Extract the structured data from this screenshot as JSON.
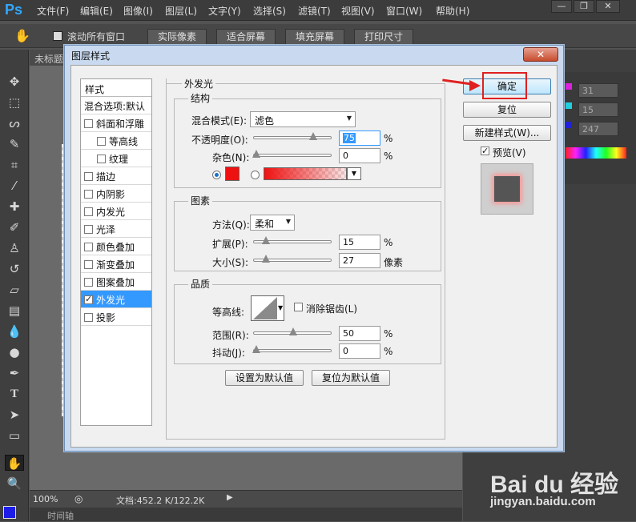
{
  "menubar": {
    "logo": "Ps",
    "items": [
      "文件(F)",
      "编辑(E)",
      "图像(I)",
      "图层(L)",
      "文字(Y)",
      "选择(S)",
      "滤镜(T)",
      "视图(V)",
      "窗口(W)",
      "帮助(H)"
    ],
    "win_buttons": [
      "—",
      "❐",
      "✕"
    ]
  },
  "options": {
    "scroll_all": "滚动所有窗口",
    "buttons": [
      "实际像素",
      "适合屏幕",
      "填充屏幕",
      "打印尺寸"
    ]
  },
  "document": {
    "tab": "未标题"
  },
  "right_panel": {
    "values": [
      "31",
      "15",
      "247"
    ]
  },
  "status": {
    "zoom": "100%",
    "doc": "文档:452.2 K/122.2K",
    "timeline": "时间轴"
  },
  "dialog": {
    "title": "图层样式",
    "styles_header": "样式",
    "blend_options": "混合选项:默认",
    "styles": [
      {
        "label": "斜面和浮雕",
        "checked": false,
        "indent": false
      },
      {
        "label": "等高线",
        "checked": false,
        "indent": true
      },
      {
        "label": "纹理",
        "checked": false,
        "indent": true
      },
      {
        "label": "描边",
        "checked": false,
        "indent": false
      },
      {
        "label": "内阴影",
        "checked": false,
        "indent": false
      },
      {
        "label": "内发光",
        "checked": false,
        "indent": false
      },
      {
        "label": "光泽",
        "checked": false,
        "indent": false
      },
      {
        "label": "颜色叠加",
        "checked": false,
        "indent": false
      },
      {
        "label": "渐变叠加",
        "checked": false,
        "indent": false
      },
      {
        "label": "图案叠加",
        "checked": false,
        "indent": false
      },
      {
        "label": "外发光",
        "checked": true,
        "indent": false,
        "active": true
      },
      {
        "label": "投影",
        "checked": false,
        "indent": false
      }
    ],
    "outer_glow": "外发光",
    "structure": {
      "title": "结构",
      "blend_mode_label": "混合模式(E):",
      "blend_mode": "滤色",
      "opacity_label": "不透明度(O):",
      "opacity": "75",
      "noise_label": "杂色(N):",
      "noise": "0",
      "pct": "%",
      "color": "#ee1111"
    },
    "elements": {
      "title": "图素",
      "technique_label": "方法(Q):",
      "technique": "柔和",
      "spread_label": "扩展(P):",
      "spread": "15",
      "size_label": "大小(S):",
      "size": "27",
      "size_unit": "像素"
    },
    "quality": {
      "title": "品质",
      "contour_label": "等高线:",
      "antialias_label": "消除锯齿(L)",
      "range_label": "范围(R):",
      "range": "50",
      "jitter_label": "抖动(J):",
      "jitter": "0"
    },
    "make_default": "设置为默认值",
    "reset_default": "复位为默认值",
    "ok": "确定",
    "reset": "复位",
    "new_style": "新建样式(W)...",
    "preview_label": "预览(V)"
  },
  "watermark": {
    "brand": "Bai du 经验",
    "url": "jingyan.baidu.com"
  }
}
